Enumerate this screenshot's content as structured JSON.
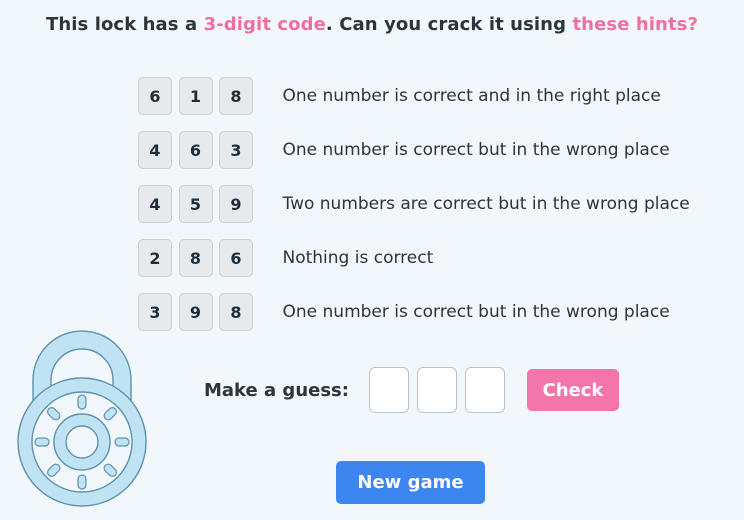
{
  "header": {
    "title_part1": "This lock has a ",
    "title_highlight1": "3-digit code",
    "title_part2": ". Can you crack it using ",
    "title_highlight2": "these hints?",
    "highlight_color": "#ef6fa4"
  },
  "hints": [
    {
      "digits": [
        "6",
        "1",
        "8"
      ],
      "text": "One number is correct and in the right place"
    },
    {
      "digits": [
        "4",
        "6",
        "3"
      ],
      "text": "One number is correct but in the wrong place"
    },
    {
      "digits": [
        "4",
        "5",
        "9"
      ],
      "text": "Two numbers are correct but in the wrong place"
    },
    {
      "digits": [
        "2",
        "8",
        "6"
      ],
      "text": "Nothing is correct"
    },
    {
      "digits": [
        "3",
        "9",
        "8"
      ],
      "text": "One number is correct but in the wrong place"
    }
  ],
  "guess": {
    "label": "Make a guess:",
    "values": [
      "",
      "",
      ""
    ],
    "check_label": "Check",
    "check_color": "#f276aa"
  },
  "new_game": {
    "label": "New game",
    "color": "#3d86ef"
  },
  "lock_icon": "padlock-icon"
}
